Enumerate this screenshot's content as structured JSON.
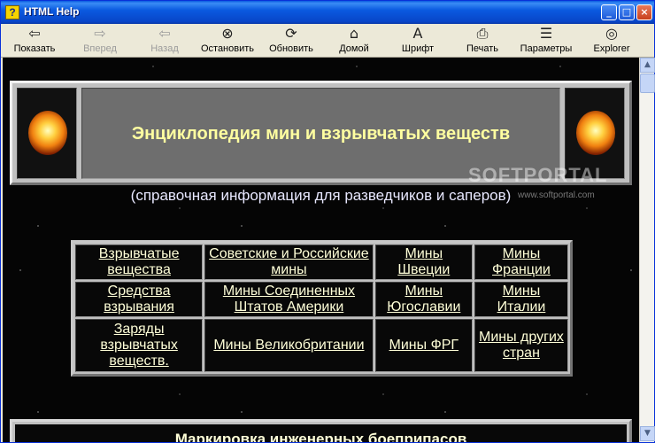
{
  "window": {
    "title": "HTML Help",
    "controls": {
      "minimize": "_",
      "maximize": "□",
      "close": "×"
    }
  },
  "toolbar": {
    "items": [
      {
        "label": "Показать",
        "icon": "show-pane-icon",
        "glyph": "⇦",
        "enabled": true
      },
      {
        "label": "Вперед",
        "icon": "forward-arrow-icon",
        "glyph": "⇨",
        "enabled": false
      },
      {
        "label": "Назад",
        "icon": "back-arrow-icon",
        "glyph": "⇦",
        "enabled": false
      },
      {
        "label": "Остановить",
        "icon": "stop-icon",
        "glyph": "⊗",
        "enabled": true
      },
      {
        "label": "Обновить",
        "icon": "refresh-icon",
        "glyph": "⟳",
        "enabled": true
      },
      {
        "label": "Домой",
        "icon": "home-icon",
        "glyph": "⌂",
        "enabled": true
      },
      {
        "label": "Шрифт",
        "icon": "font-icon",
        "glyph": "A",
        "enabled": true
      },
      {
        "label": "Печать",
        "icon": "print-icon",
        "glyph": "⎙",
        "enabled": true
      },
      {
        "label": "Параметры",
        "icon": "options-icon",
        "glyph": "☰",
        "enabled": true
      },
      {
        "label": "Explorer",
        "icon": "explorer-icon",
        "glyph": "◎",
        "enabled": true
      }
    ]
  },
  "page": {
    "banner_title": "Энциклопедия мин и взрывчатых веществ",
    "subtitle": "(справочная информация для разведчиков и саперов)",
    "watermark": "SOFTPORTAL",
    "watermark_sub": "www.softportal.com",
    "table": [
      [
        "Взрывчатые вещества",
        "Советские и Российские мины",
        "Мины Швеции",
        "Мины Франции"
      ],
      [
        "Средства взрывания",
        "Мины Соединенных Штатов Америки",
        "Мины Югославии",
        "Мины Италии"
      ],
      [
        "Заряды взрывчатых веществ.",
        "Мины Великобритании",
        "Мины ФРГ",
        "Мины других стран"
      ]
    ],
    "bottom_heading": "Маркировка инженерных боеприпасов"
  },
  "scrollbar": {
    "up": "▲",
    "down": "▼"
  },
  "colors": {
    "titlebar": "#0a5ae0",
    "link": "#ffffd8",
    "banner_text": "#ffffa0",
    "background": "#050505"
  }
}
